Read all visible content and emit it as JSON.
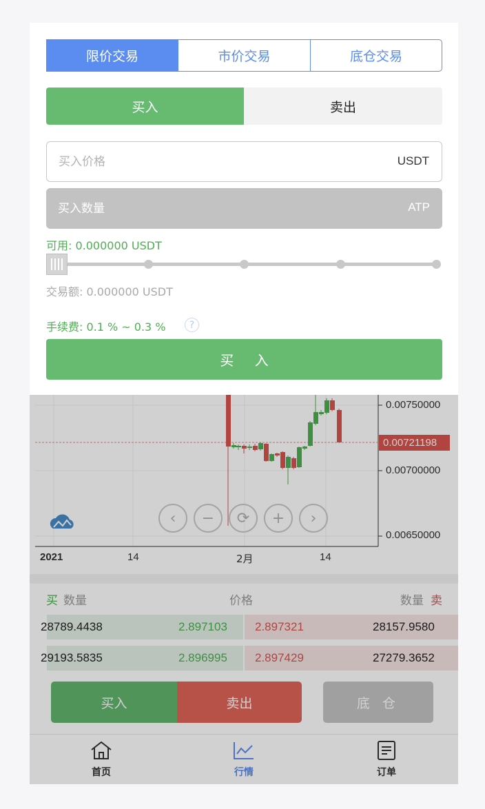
{
  "panel": {
    "order_types": [
      "限价交易",
      "市价交易",
      "底仓交易"
    ],
    "side_buy": "买入",
    "side_sell": "卖出",
    "price_placeholder": "买入价格",
    "price_unit": "USDT",
    "amount_placeholder": "买入数量",
    "amount_unit": "ATP",
    "available": "可用: 0.000000 USDT",
    "slider_percent": 0,
    "trade_amount": "交易额: 0.000000 USDT",
    "fee": "手续费: 0.1 % ~ 0.3 %",
    "help_icon": "?",
    "confirm": "买 入"
  },
  "chart": {
    "price_ticks": [
      "0.00750000",
      "0.00700000",
      "0.00650000"
    ],
    "last_price": "0.00721198",
    "date_ticks": [
      "2021",
      "14",
      "2月",
      "14"
    ],
    "controls": [
      "‹",
      "−",
      "⟳",
      "+",
      "›"
    ]
  },
  "book": {
    "buy_label": "买",
    "qty_label": "数量",
    "price_label": "价格",
    "sell_label": "卖",
    "rows": [
      {
        "bid_qty": "28789.4438",
        "bid_price": "2.897103",
        "ask_price": "2.897321",
        "ask_qty": "28157.9580"
      },
      {
        "bid_qty": "29193.5835",
        "bid_price": "2.896995",
        "ask_price": "2.897429",
        "ask_qty": "27279.3652"
      }
    ]
  },
  "actions": {
    "buy": "买入",
    "sell": "卖出",
    "base": "底 仓"
  },
  "tabs": [
    {
      "label": "首页",
      "icon": "home-icon"
    },
    {
      "label": "行情",
      "icon": "chart-icon"
    },
    {
      "label": "订单",
      "icon": "order-icon"
    }
  ],
  "colors": {
    "accent_blue": "#5b8cf0",
    "buy_green": "#66bb70",
    "sell_red": "#d9534f"
  }
}
